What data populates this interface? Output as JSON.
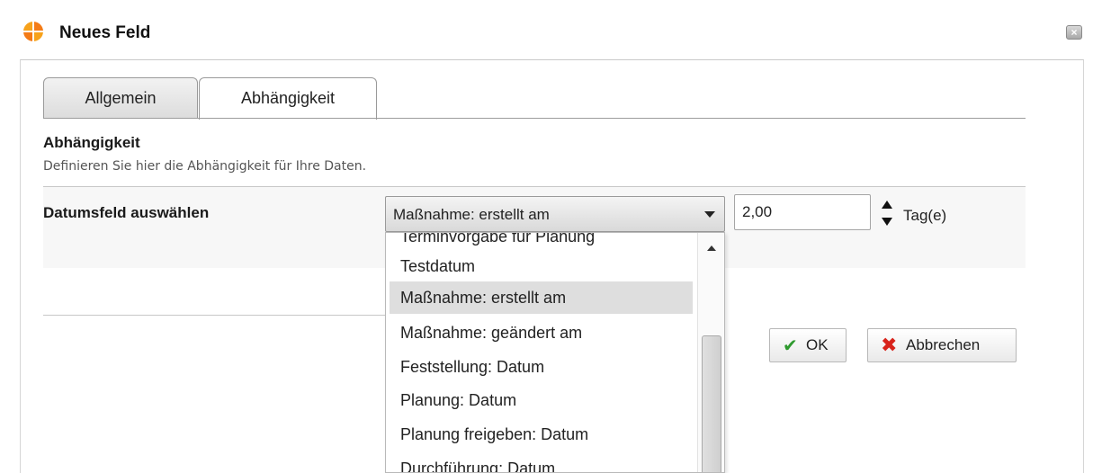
{
  "window": {
    "title": "Neues Feld",
    "close_label": "×"
  },
  "tabs": [
    {
      "label": "Allgemein",
      "active": false
    },
    {
      "label": "Abhängigkeit",
      "active": true
    }
  ],
  "section": {
    "title": "Abhängigkeit",
    "description": "Definieren Sie hier die Abhängigkeit für Ihre Daten."
  },
  "date_field": {
    "label": "Datumsfeld auswählen",
    "selected": "Maßnahme: erstellt am",
    "offset_value": "2,00",
    "unit": "Tag(e)"
  },
  "dropdown": {
    "options": [
      "Terminvorgabe für Planung",
      "Testdatum",
      "Maßnahme: erstellt am",
      "Maßnahme: geändert am",
      "Feststellung: Datum",
      "Planung: Datum",
      "Planung freigeben: Datum",
      "Durchführung: Datum"
    ],
    "selected_index": 2
  },
  "buttons": {
    "ok_label": "OK",
    "cancel_label": "Abbrechen"
  },
  "icons": {
    "app": "app-logo-icon",
    "ok": "checkmark-icon",
    "cancel": "x-icon"
  },
  "colors": {
    "ok_icon": "#2e9a2e",
    "cancel_icon": "#d8231b",
    "selected_item_bg": "#dedede",
    "logo_primary": "#f7a21b",
    "logo_secondary": "#f47b16"
  }
}
